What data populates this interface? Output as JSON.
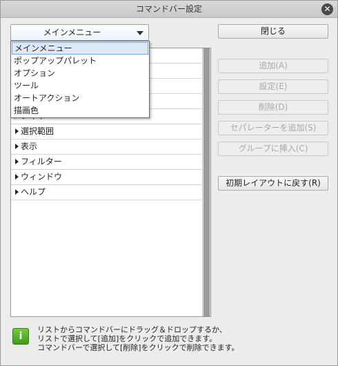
{
  "window": {
    "title": "コマンドバー設定",
    "close_icon": "close-icon"
  },
  "select": {
    "value": "メインメニュー"
  },
  "dropdown": {
    "options": [
      "メインメニュー",
      "ポップアップパレット",
      "オプション",
      "ツール",
      "オートアクション",
      "描画色"
    ]
  },
  "tree": {
    "items": [
      {
        "label": ""
      },
      {
        "label": ""
      },
      {
        "label": ""
      },
      {
        "label": ""
      },
      {
        "label": "レイヤー"
      },
      {
        "label": "選択範囲"
      },
      {
        "label": "表示"
      },
      {
        "label": "フィルター"
      },
      {
        "label": "ウィンドウ"
      },
      {
        "label": "ヘルプ"
      }
    ]
  },
  "buttons": {
    "close": "閉じる",
    "add": "追加(A)",
    "settings": "設定(E)",
    "delete": "削除(D)",
    "add_separator": "セパレーターを追加(S)",
    "insert_group": "グループに挿入(C)",
    "reset_layout": "初期レイアウトに戻す(R)"
  },
  "help": {
    "icon": "info-icon",
    "lines": [
      "リストからコマンドバーにドラッグ＆ドロップするか、",
      "リストで選択して[追加]をクリックで追加できます。",
      "コマンドバーで選択して[削除]をクリックで削除できます。"
    ]
  }
}
